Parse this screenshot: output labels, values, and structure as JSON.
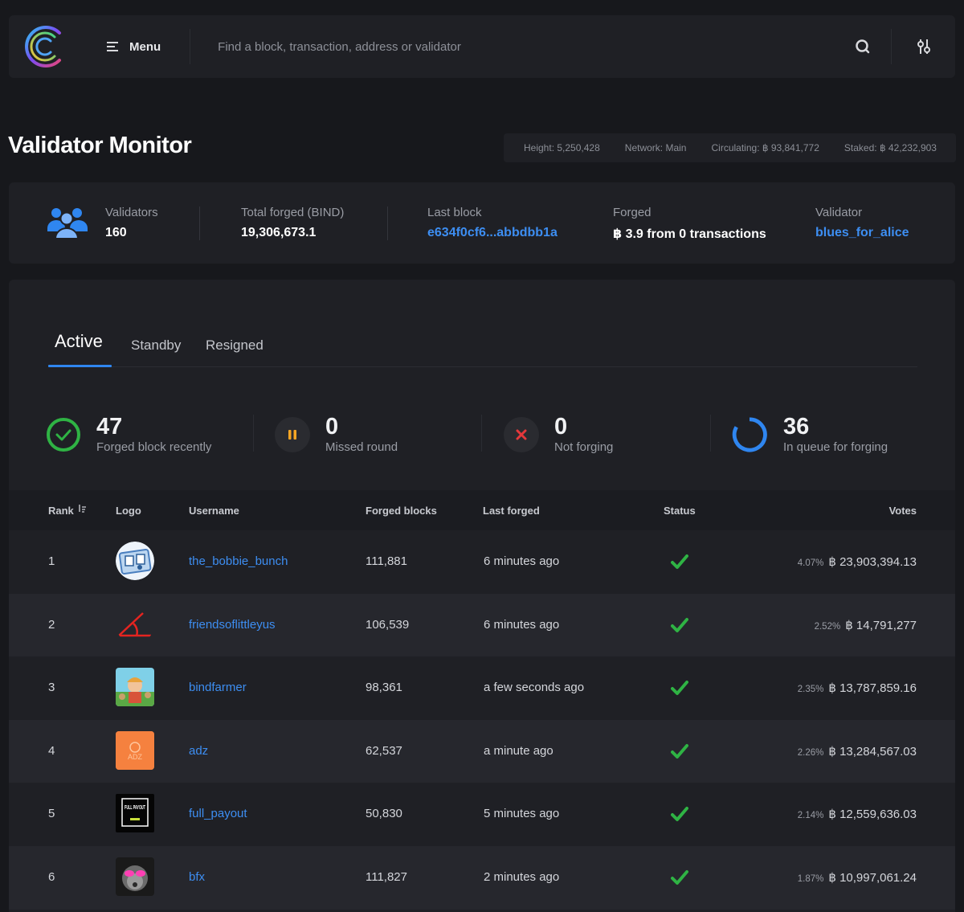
{
  "topbar": {
    "menu_label": "Menu",
    "search_placeholder": "Find a block, transaction, address or validator",
    "icons": {
      "logo": "brand-c-logo",
      "menu": "menu-icon",
      "search": "search-icon",
      "settings": "sliders-icon"
    }
  },
  "header": {
    "title": "Validator Monitor",
    "stats": {
      "height": "Height: 5,250,428",
      "network": "Network: Main",
      "circulating": "Circulating: ฿ 93,841,772",
      "staked": "Staked: ฿ 42,232,903"
    }
  },
  "summary": {
    "validators_label": "Validators",
    "validators_value": "160",
    "total_forged_label": "Total forged (BIND)",
    "total_forged_value": "19,306,673.1",
    "last_block_label": "Last block",
    "last_block_value": "e634f0cf6...abbdbb1a",
    "forged_label": "Forged",
    "forged_value": "฿ 3.9 from 0 transactions",
    "validator_label": "Validator",
    "validator_value": "blues_for_alice"
  },
  "tabs": [
    "Active",
    "Standby",
    "Resigned"
  ],
  "counters": [
    {
      "num": "47",
      "caption": "Forged block recently"
    },
    {
      "num": "0",
      "caption": "Missed round"
    },
    {
      "num": "0",
      "caption": "Not forging"
    },
    {
      "num": "36",
      "caption": "In queue for forging"
    }
  ],
  "table": {
    "headers": {
      "rank": "Rank",
      "logo": "Logo",
      "username": "Username",
      "forged": "Forged blocks",
      "last": "Last forged",
      "status": "Status",
      "votes": "Votes"
    },
    "rows": [
      {
        "rank": "1",
        "username": "the_bobbie_bunch",
        "forged": "111,881",
        "last": "6 minutes ago",
        "pct": "4.07%",
        "votes": "฿ 23,903,394.13"
      },
      {
        "rank": "2",
        "username": "friendsoflittleyus",
        "forged": "106,539",
        "last": "6 minutes ago",
        "pct": "2.52%",
        "votes": "฿ 14,791,277"
      },
      {
        "rank": "3",
        "username": "bindfarmer",
        "forged": "98,361",
        "last": "a few seconds ago",
        "pct": "2.35%",
        "votes": "฿ 13,787,859.16"
      },
      {
        "rank": "4",
        "username": "adz",
        "forged": "62,537",
        "last": "a minute ago",
        "pct": "2.26%",
        "votes": "฿ 13,284,567.03"
      },
      {
        "rank": "5",
        "username": "full_payout",
        "forged": "50,830",
        "last": "5 minutes ago",
        "pct": "2.14%",
        "votes": "฿ 12,559,636.03"
      },
      {
        "rank": "6",
        "username": "bfx",
        "forged": "111,827",
        "last": "2 minutes ago",
        "pct": "1.87%",
        "votes": "฿ 10,997,061.24"
      }
    ],
    "logo_text": {
      "adz": "ADZ",
      "full_payout": "FULL PAYOUT"
    }
  }
}
